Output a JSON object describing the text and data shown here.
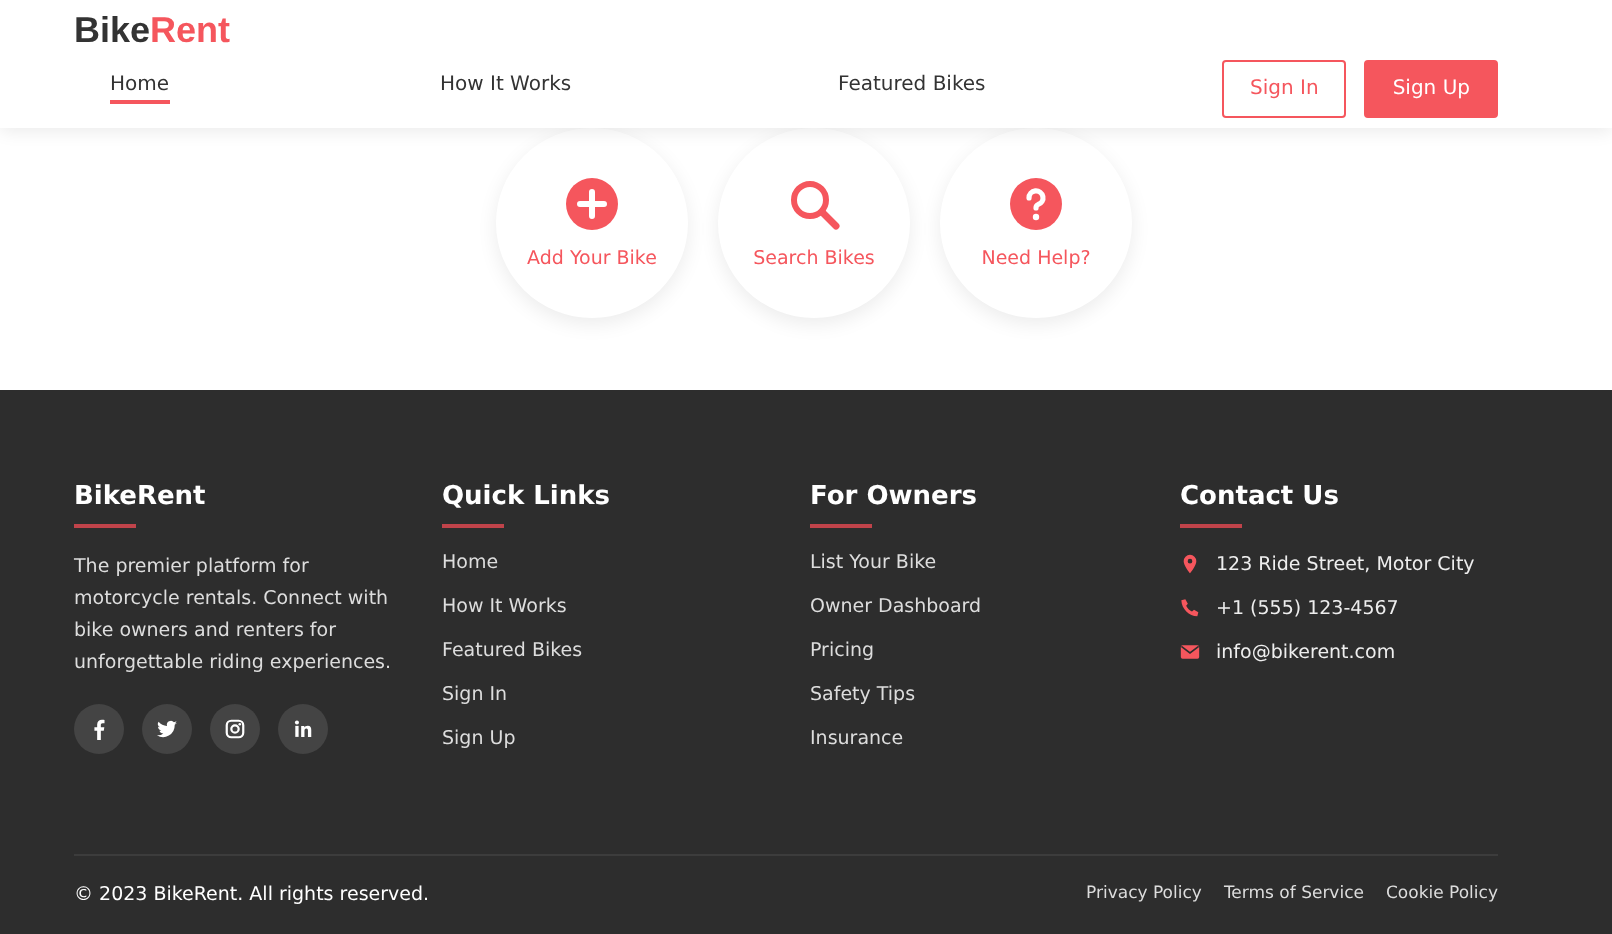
{
  "header": {
    "logo": {
      "first": "Bike",
      "accent": "Rent"
    },
    "nav": [
      {
        "label": "Home",
        "selected": true
      },
      {
        "label": "How It Works",
        "selected": false
      },
      {
        "label": "Featured Bikes",
        "selected": false
      }
    ],
    "buttons": [
      {
        "label": "Sign In",
        "kind": "outline"
      },
      {
        "label": "Sign Up",
        "kind": "filled"
      }
    ]
  },
  "quick_actions": [
    {
      "label": "Add Your Bike",
      "kind": "add"
    },
    {
      "label": "Search Bikes",
      "kind": "search"
    },
    {
      "label": "Need Help?",
      "kind": "help"
    }
  ],
  "footer": {
    "about": {
      "title": "BikeRent",
      "text": "The premier platform for motorcycle rentals. Connect with bike owners and renters for unforgettable riding experiences.",
      "social": [
        {
          "kind": "facebook"
        },
        {
          "kind": "twitter"
        },
        {
          "kind": "instagram"
        },
        {
          "kind": "linkedin"
        }
      ]
    },
    "quick_links": {
      "title": "Quick Links",
      "items": [
        "Home",
        "How It Works",
        "Featured Bikes",
        "Sign In",
        "Sign Up"
      ]
    },
    "for_owners": {
      "title": "For Owners",
      "items": [
        "List Your Bike",
        "Owner Dashboard",
        "Pricing",
        "Safety Tips",
        "Insurance"
      ]
    },
    "contact": {
      "title": "Contact Us",
      "items": [
        {
          "kind": "address",
          "text": "123 Ride Street, Motor City"
        },
        {
          "kind": "phone",
          "text": "+1 (555) 123-4567"
        },
        {
          "kind": "email",
          "text": "info@bikerent.com"
        }
      ]
    },
    "copyright": "© 2023 BikeRent. All rights reserved.",
    "legal_links": [
      "Privacy Policy",
      "Terms of Service",
      "Cookie Policy"
    ]
  }
}
